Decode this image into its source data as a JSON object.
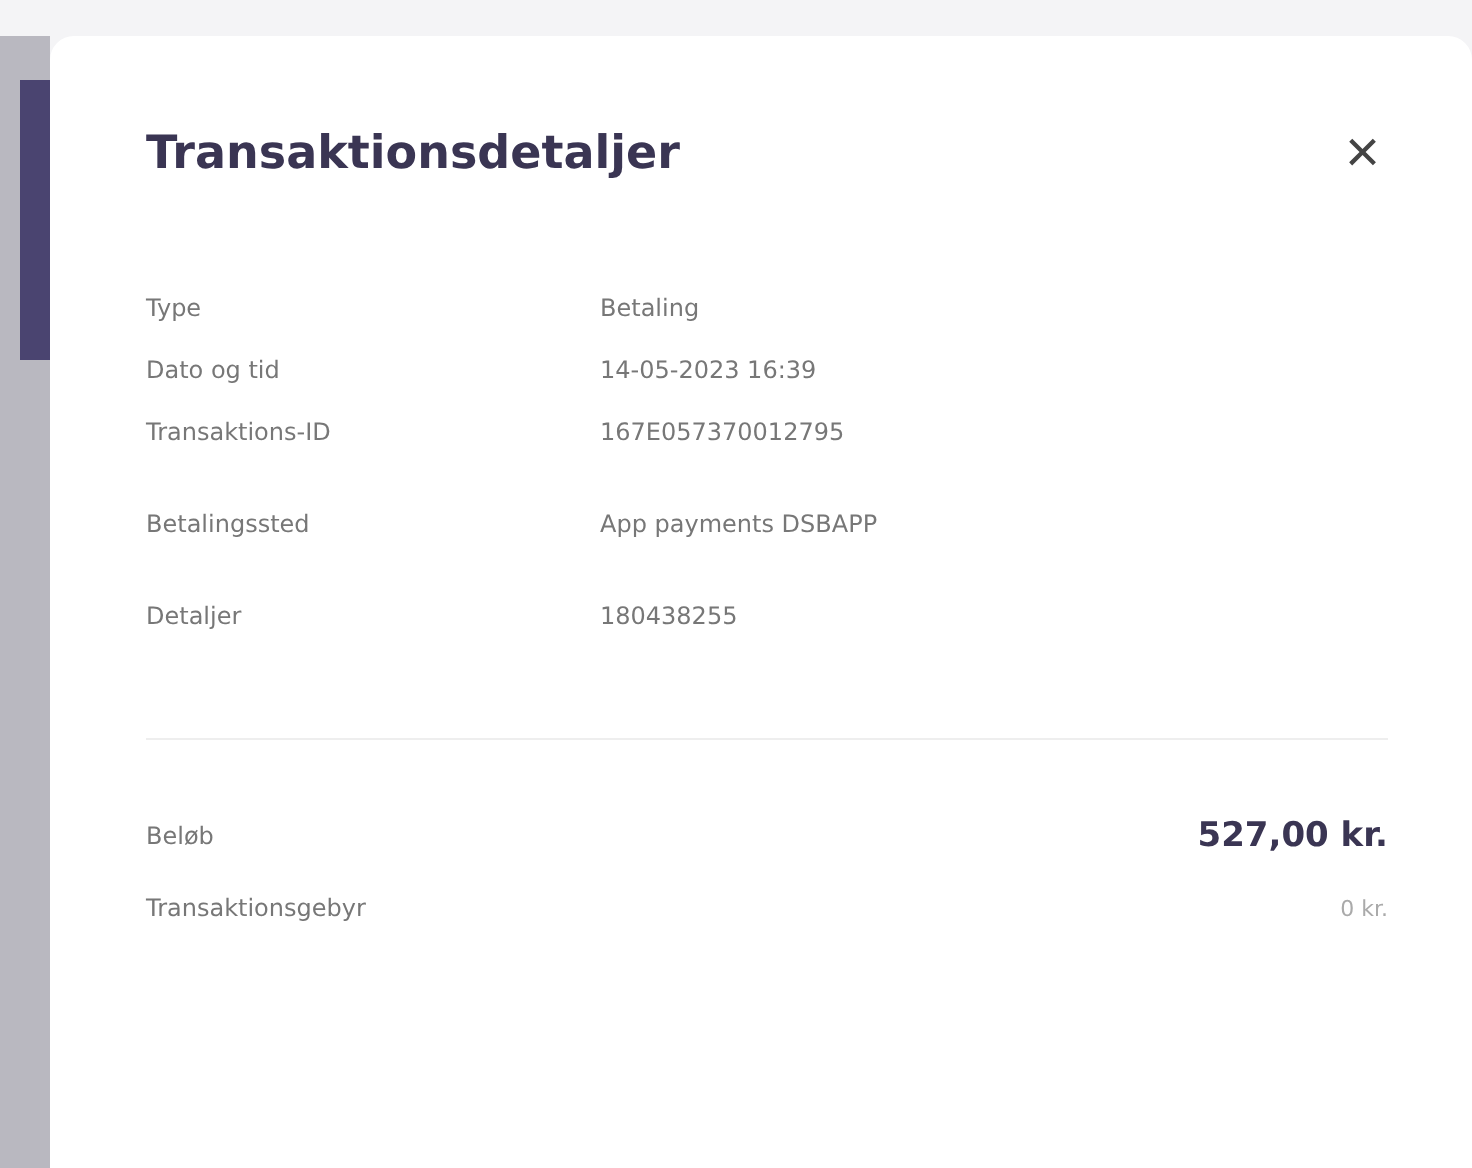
{
  "dialog": {
    "title": "Transaktionsdetaljer",
    "close": "×",
    "detail_groups": [
      [
        {
          "label": "Type",
          "value": "Betaling"
        },
        {
          "label": "Dato og tid",
          "value": "14-05-2023 16:39"
        },
        {
          "label": "Transaktions-ID",
          "value": "167E057370012795"
        }
      ],
      [
        {
          "label": "Betalingssted",
          "value": "App payments DSBAPP"
        }
      ],
      [
        {
          "label": "Detaljer",
          "value": "180438255"
        }
      ]
    ],
    "totals": [
      {
        "label": "Beløb",
        "value": "527,00 kr.",
        "kind": "amount"
      },
      {
        "label": "Transaktionsgebyr",
        "value": "0 kr.",
        "kind": "fee"
      }
    ]
  }
}
